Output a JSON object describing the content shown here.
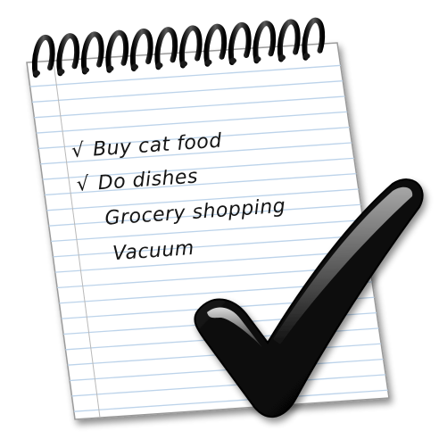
{
  "notepad": {
    "items": [
      {
        "text": "Buy cat food",
        "checked": true,
        "check_mark": "√"
      },
      {
        "text": "Do dishes",
        "checked": true,
        "check_mark": "√"
      },
      {
        "text": "Grocery shopping",
        "checked": false
      },
      {
        "text": "Vacuum",
        "checked": false
      }
    ]
  },
  "icons": {
    "big_check": "checkmark-icon",
    "spiral": "spiral-binding-icon"
  },
  "colors": {
    "paper": "#ffffff",
    "rule_line": "#bcd3ea",
    "margin_line": "#b9b9b9",
    "ink": "#141414",
    "check_dark": "#0c0c0c",
    "check_highlight": "#bdbdbd",
    "ring": "#1a1a1a"
  }
}
